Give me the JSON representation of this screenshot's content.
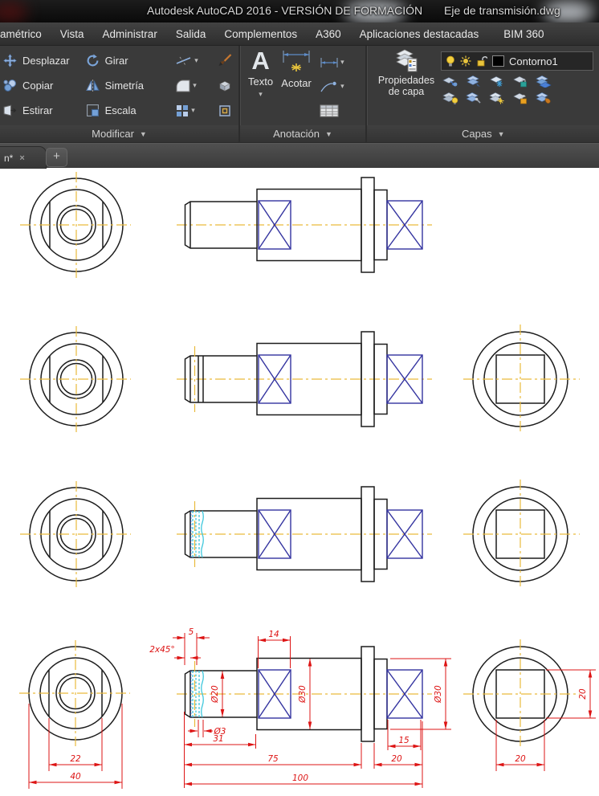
{
  "title_bar": {
    "app_title": "Autodesk AutoCAD 2016 - VERSIÓN DE FORMACIÓN",
    "doc_title": "Eje de transmisión.dwg"
  },
  "menu": {
    "items": [
      "amétrico",
      "Vista",
      "Administrar",
      "Salida",
      "Complementos",
      "A360",
      "Aplicaciones destacadas",
      "BIM 360"
    ]
  },
  "ribbon": {
    "modificar": {
      "title": "Modificar",
      "desplazar": "Desplazar",
      "copiar": "Copiar",
      "estirar": "Estirar",
      "girar": "Girar",
      "simetria": "Simetría",
      "escala": "Escala"
    },
    "anotacion": {
      "title": "Anotación",
      "texto": "Texto",
      "acotar": "Acotar"
    },
    "capas": {
      "title": "Capas",
      "propiedades_line1": "Propiedades",
      "propiedades_line2": "de capa",
      "layer_name": "Contorno1"
    }
  },
  "tab_bar": {
    "drawing_tab": "n*",
    "close": "×",
    "new_tab": "+"
  },
  "drawing": {
    "dims": {
      "front_flats": "22",
      "front_outer": "40",
      "groove_offset": "5",
      "chamfer": "2x45°",
      "left_hub_len": "14",
      "shaft_dia": "Ø20",
      "body_dia": "Ø30",
      "groove_dia": "Ø3",
      "shaft_len": "31",
      "body_len": "75",
      "right_hub_len": "15",
      "right_end_len": "20",
      "total_len": "100",
      "right_dia": "Ø30",
      "square_height": "20",
      "square_width": "20"
    },
    "colors": {
      "outline": "#1c1c1c",
      "centerline": "#e9ba3c",
      "bearing_blue": "#3434a0",
      "thread_cyan": "#3ec7dc",
      "dimension_red": "#dd1414"
    }
  }
}
